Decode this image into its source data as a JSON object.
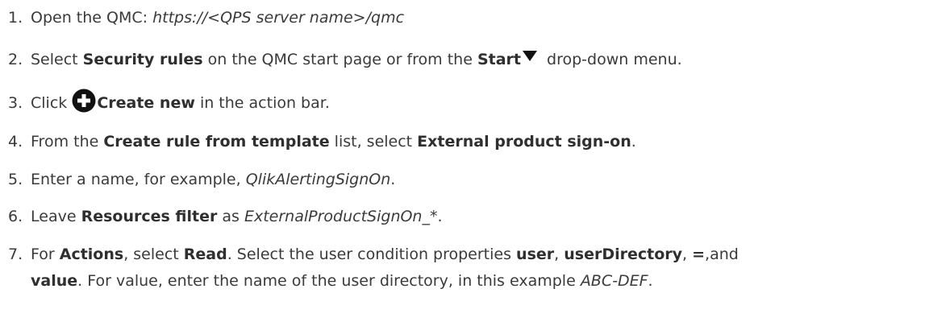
{
  "steps": [
    {
      "number": "1.",
      "prefix": "Open the QMC: ",
      "url": "https://<QPS server name>/qmc"
    },
    {
      "number": "2.",
      "t1": "Select ",
      "b1": "Security rules",
      "t2": " on the QMC start page or from the ",
      "b2": "Start",
      "t3": " drop-down menu."
    },
    {
      "number": "3.",
      "t1": "Click ",
      "b1": "Create new",
      "t2": " in the action bar."
    },
    {
      "number": "4.",
      "t1": "From the ",
      "b1": "Create rule from template",
      "t2": " list, select ",
      "b2": "External product sign-on",
      "t3": "."
    },
    {
      "number": "5.",
      "t1": "Enter a name, for example, ",
      "i1": "QlikAlertingSignOn",
      "t2": "."
    },
    {
      "number": "6.",
      "t1": "Leave ",
      "b1": "Resources filter",
      "t2": " as ",
      "i1": "ExternalProductSignOn_*",
      "t3": "."
    },
    {
      "number": "7.",
      "t1": "For ",
      "b1": "Actions",
      "t2": ", select ",
      "b2": "Read",
      "t3": ". Select the user condition properties ",
      "b3": "user",
      "t4": ", ",
      "b4": "userDirectory",
      "t5": ", ",
      "b5": "=",
      "t6": ",and",
      "l2b1": "value",
      "l2t1": ". For value, enter the name of the user directory, in this example ",
      "l2i1": "ABC-DEF",
      "l2t2": "."
    }
  ]
}
